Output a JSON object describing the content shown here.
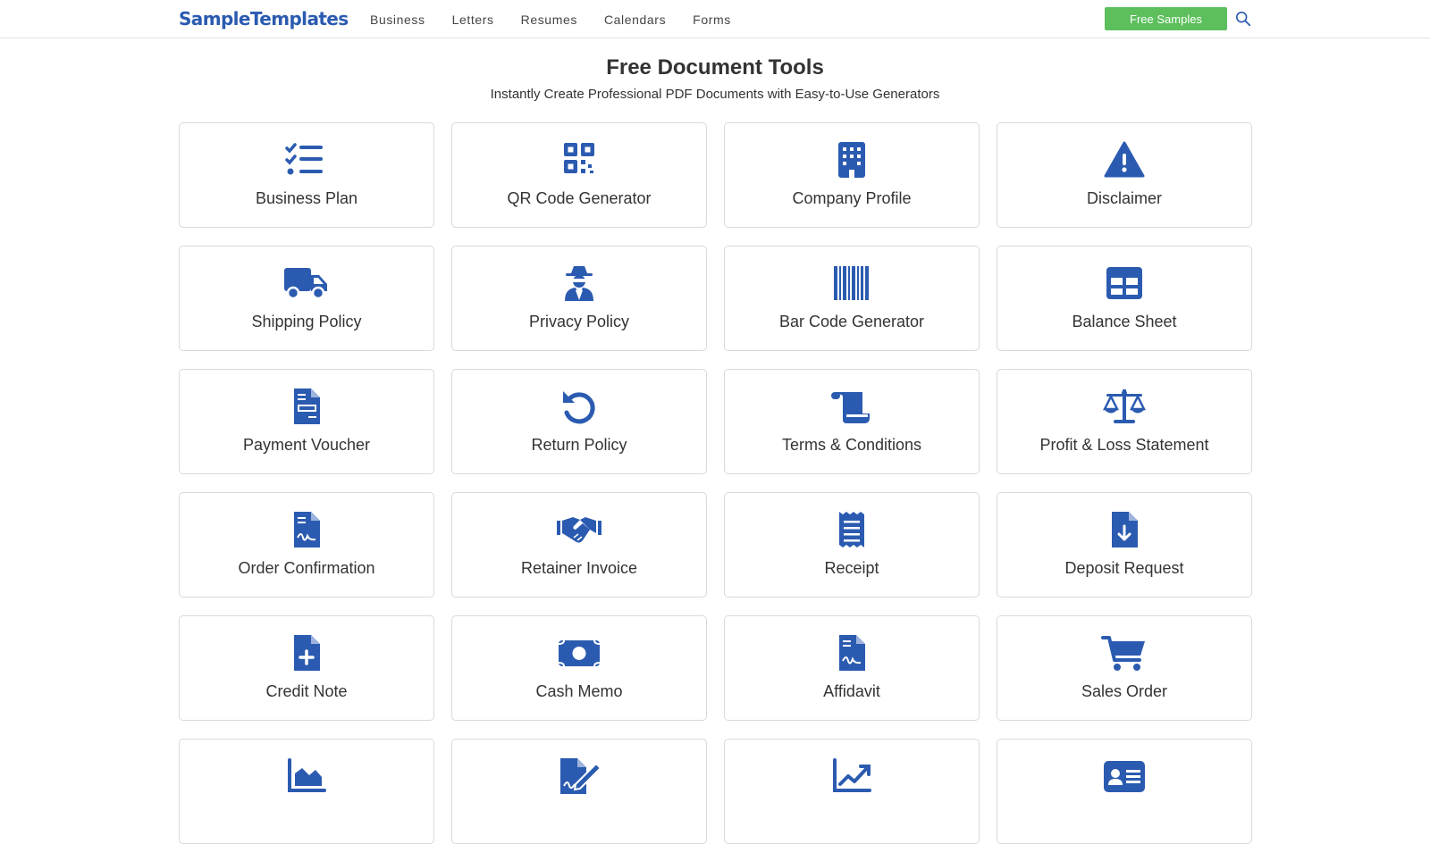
{
  "header": {
    "logo": "SampleTemplates",
    "nav": [
      "Business",
      "Letters",
      "Resumes",
      "Calendars",
      "Forms"
    ],
    "cta_label": "Free Samples",
    "search_icon": "search-icon"
  },
  "page": {
    "title": "Free Document Tools",
    "subtitle": "Instantly Create Professional PDF Documents with Easy-to-Use Generators"
  },
  "colors": {
    "accent": "#2b5bb0",
    "cta": "#5cbf5c",
    "border": "#d9d9d9"
  },
  "tools": [
    {
      "label": "Business Plan",
      "icon": "list-check-icon"
    },
    {
      "label": "QR Code Generator",
      "icon": "qrcode-icon"
    },
    {
      "label": "Company Profile",
      "icon": "building-icon"
    },
    {
      "label": "Disclaimer",
      "icon": "warning-icon"
    },
    {
      "label": "Shipping Policy",
      "icon": "truck-icon"
    },
    {
      "label": "Privacy Policy",
      "icon": "user-secret-icon"
    },
    {
      "label": "Bar Code Generator",
      "icon": "barcode-icon"
    },
    {
      "label": "Balance Sheet",
      "icon": "table-icon"
    },
    {
      "label": "Payment Voucher",
      "icon": "file-invoice-icon"
    },
    {
      "label": "Return Policy",
      "icon": "rotate-left-icon"
    },
    {
      "label": "Terms & Conditions",
      "icon": "scroll-icon"
    },
    {
      "label": "Profit & Loss Statement",
      "icon": "scale-balanced-icon"
    },
    {
      "label": "Order Confirmation",
      "icon": "file-signature-icon"
    },
    {
      "label": "Retainer Invoice",
      "icon": "handshake-icon"
    },
    {
      "label": "Receipt",
      "icon": "receipt-icon"
    },
    {
      "label": "Deposit Request",
      "icon": "file-arrow-down-icon"
    },
    {
      "label": "Credit Note",
      "icon": "file-plus-icon"
    },
    {
      "label": "Cash Memo",
      "icon": "money-bill-icon"
    },
    {
      "label": "Affidavit",
      "icon": "file-signature-icon"
    },
    {
      "label": "Sales Order",
      "icon": "cart-icon"
    },
    {
      "label": "",
      "icon": "area-chart-icon"
    },
    {
      "label": "",
      "icon": "file-pen-icon"
    },
    {
      "label": "",
      "icon": "line-chart-icon"
    },
    {
      "label": "",
      "icon": "id-card-icon"
    }
  ]
}
